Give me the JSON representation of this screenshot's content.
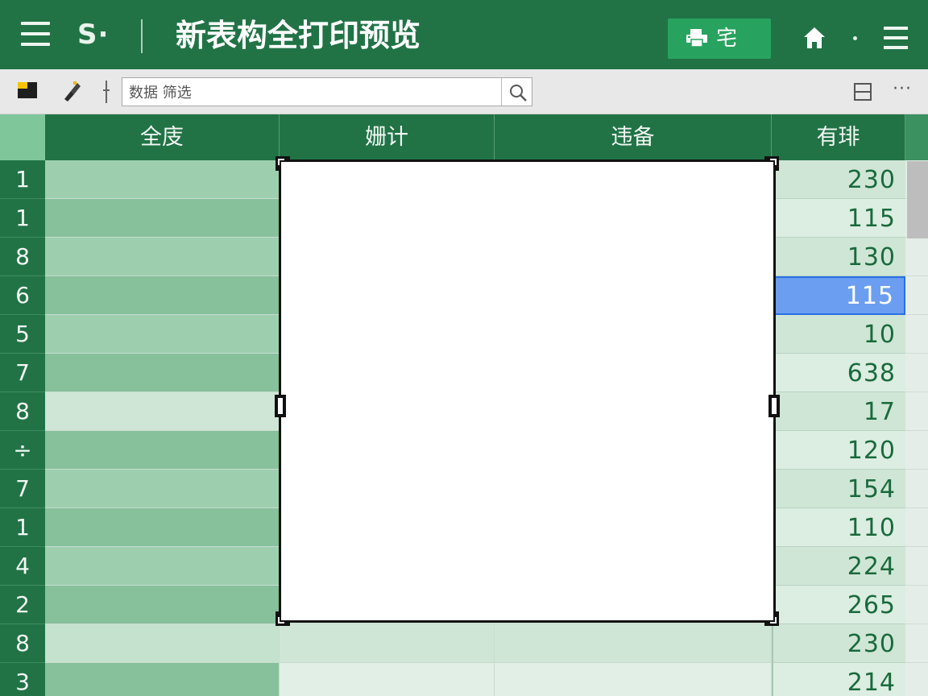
{
  "titlebar": {
    "app_logo": "S·",
    "title": "新表构全打印预览",
    "print_button_label": "宅"
  },
  "toolbar": {
    "search_value": "数据 筛选",
    "more_label": "···"
  },
  "columns": [
    "全庋",
    "姗计",
    "违备",
    "有琲"
  ],
  "rows": [
    {
      "header": "1",
      "value": "230"
    },
    {
      "header": "1",
      "value": "115"
    },
    {
      "header": "8",
      "value": "130"
    },
    {
      "header": "6",
      "value": "115"
    },
    {
      "header": "5",
      "value": "10"
    },
    {
      "header": "7",
      "value": "638"
    },
    {
      "header": "8",
      "value": "17"
    },
    {
      "header": "÷",
      "value": "120"
    },
    {
      "header": "7",
      "value": "154"
    },
    {
      "header": "1",
      "value": "110"
    },
    {
      "header": "4",
      "value": "224"
    },
    {
      "header": "2",
      "value": "265"
    },
    {
      "header": "8",
      "value": "230"
    },
    {
      "header": "3",
      "value": "214"
    }
  ],
  "selected_row": 3,
  "colors": {
    "brand_green": "#217346",
    "print_button": "#27a35f",
    "selection": "#6b9ef0",
    "selection_border": "#2a6fe6"
  }
}
